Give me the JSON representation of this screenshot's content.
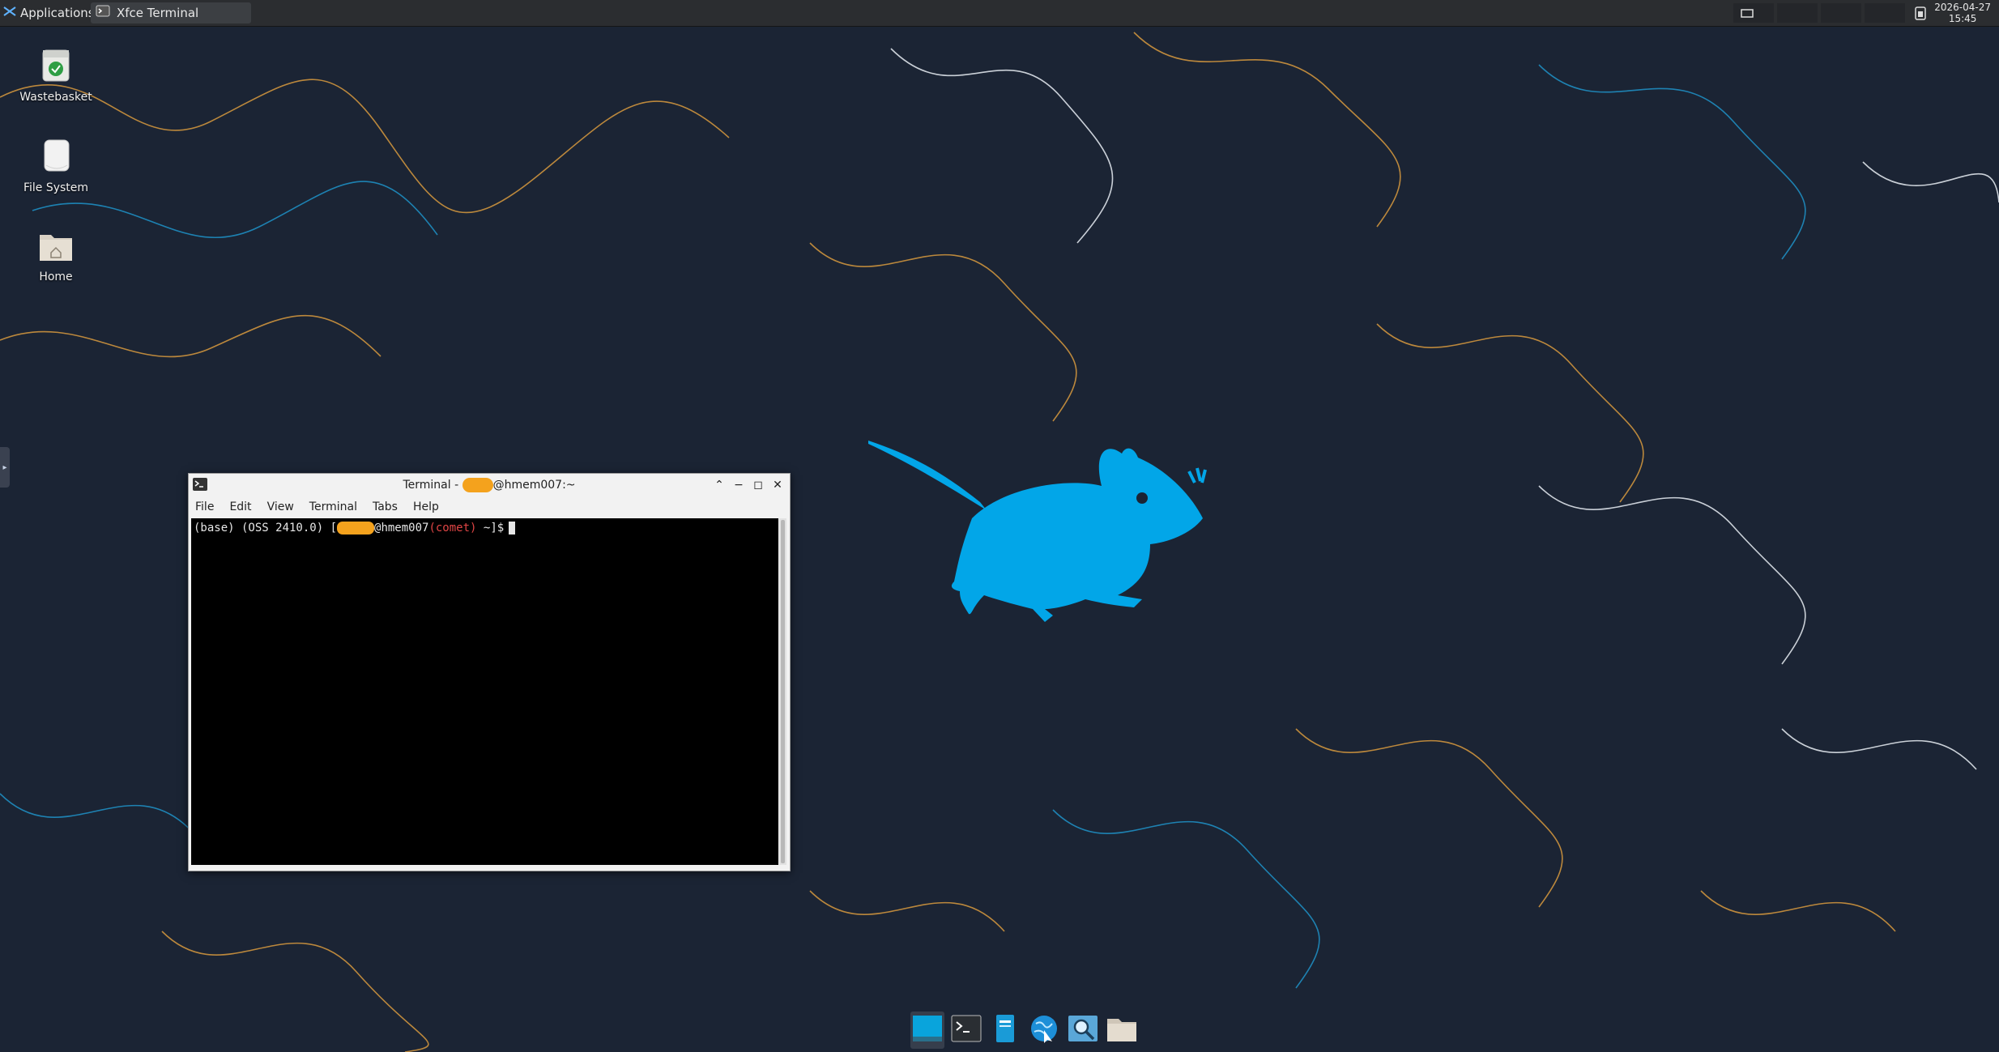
{
  "panel": {
    "applications_label": "Applications",
    "menu_sep": ":",
    "task_label": "Xfce Terminal",
    "clock_date": "2026-04-27",
    "clock_time": "15:45"
  },
  "desktop": {
    "icons": [
      {
        "label": "Wastebasket"
      },
      {
        "label": "File System"
      },
      {
        "label": "Home"
      }
    ]
  },
  "terminal": {
    "title_prefix": "Terminal - ",
    "title_suffix": "@hmem007:~",
    "menu": [
      "File",
      "Edit",
      "View",
      "Terminal",
      "Tabs",
      "Help"
    ],
    "prompt_env": "(base) (OSS 2410.0) [",
    "prompt_host": "@hmem007",
    "prompt_cluster": "(comet)",
    "prompt_end": " ~]$"
  },
  "dock": {
    "items": [
      "show-desktop-icon",
      "terminal-icon",
      "text-editor-icon",
      "web-browser-icon",
      "search-icon",
      "file-manager-icon"
    ]
  },
  "colors": {
    "wallpaper_bg": "#1b2434",
    "line_orange": "#d89a3e",
    "line_blue": "#1e93c9",
    "line_white": "#e9eef5",
    "mouse_blue": "#02a6e8",
    "redaction": "#f4a21d",
    "prompt_red": "#e04545"
  }
}
